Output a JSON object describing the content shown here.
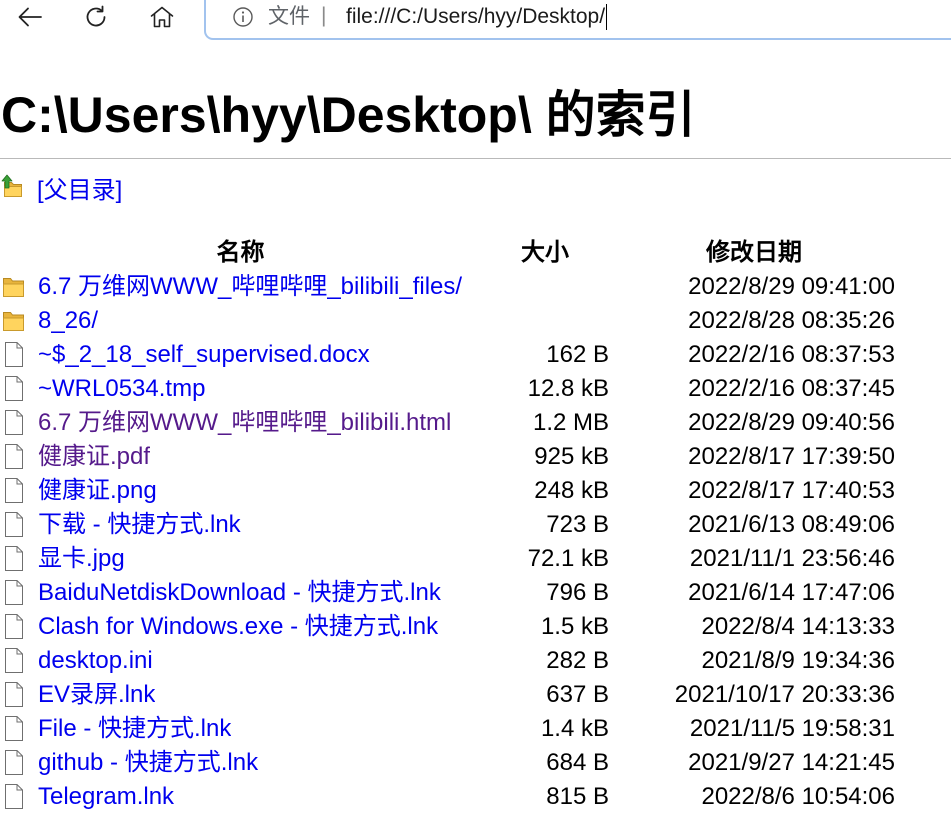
{
  "browser": {
    "back_icon": "arrow-left-icon",
    "refresh_icon": "refresh-icon",
    "home_icon": "home-icon",
    "address_bar": {
      "info_icon": "info-icon",
      "scheme_label": "文件",
      "separator": "|",
      "url": "file:///C:/Users/hyy/Desktop/"
    }
  },
  "page": {
    "title": "C:\\Users\\hyy\\Desktop\\ 的索引",
    "parent_icon": "parent-folder-icon",
    "parent_link": "[父目录]",
    "columns": {
      "name": "名称",
      "size": "大小",
      "modified": "修改日期"
    },
    "entries": [
      {
        "icon": "folder-icon",
        "name": "6.7 万维网WWW_哔哩哔哩_bilibili_files/",
        "modified": "2022/8/29 09:41:00",
        "visited": false
      },
      {
        "icon": "folder-icon",
        "name": "8_26/",
        "modified": "2022/8/28 08:35:26",
        "visited": false
      },
      {
        "icon": "file-icon",
        "name": "~$_2_18_self_supervised.docx",
        "size": "162 B",
        "modified": "2022/2/16 08:37:53",
        "visited": false
      },
      {
        "icon": "file-icon",
        "name": "~WRL0534.tmp",
        "size": "12.8 kB",
        "modified": "2022/2/16 08:37:45",
        "visited": false
      },
      {
        "icon": "file-icon",
        "name": "6.7 万维网WWW_哔哩哔哩_bilibili.html",
        "size": "1.2 MB",
        "modified": "2022/8/29 09:40:56",
        "visited": true
      },
      {
        "icon": "file-icon",
        "name": "健康证.pdf",
        "size": "925 kB",
        "modified": "2022/8/17 17:39:50",
        "visited": true
      },
      {
        "icon": "file-icon",
        "name": "健康证.png",
        "size": "248 kB",
        "modified": "2022/8/17 17:40:53",
        "visited": false
      },
      {
        "icon": "file-icon",
        "name": "下载 - 快捷方式.lnk",
        "size": "723 B",
        "modified": "2021/6/13 08:49:06",
        "visited": false
      },
      {
        "icon": "file-icon",
        "name": "显卡.jpg",
        "size": "72.1 kB",
        "modified": "2021/11/1 23:56:46",
        "visited": false
      },
      {
        "icon": "file-icon",
        "name": "BaiduNetdiskDownload - 快捷方式.lnk",
        "size": "796 B",
        "modified": "2021/6/14 17:47:06",
        "visited": false
      },
      {
        "icon": "file-icon",
        "name": "Clash for Windows.exe - 快捷方式.lnk",
        "size": "1.5 kB",
        "modified": "2022/8/4 14:13:33",
        "visited": false
      },
      {
        "icon": "file-icon",
        "name": "desktop.ini",
        "size": "282 B",
        "modified": "2021/8/9 19:34:36",
        "visited": false
      },
      {
        "icon": "file-icon",
        "name": "EV录屏.lnk",
        "size": "637 B",
        "modified": "2021/10/17 20:33:36",
        "visited": false
      },
      {
        "icon": "file-icon",
        "name": "File - 快捷方式.lnk",
        "size": "1.4 kB",
        "modified": "2021/11/5 19:58:31",
        "visited": false
      },
      {
        "icon": "file-icon",
        "name": "github - 快捷方式.lnk",
        "size": "684 B",
        "modified": "2021/9/27 14:21:45",
        "visited": false
      },
      {
        "icon": "file-icon",
        "name": "Telegram.lnk",
        "size": "815 B",
        "modified": "2022/8/6 10:54:06",
        "visited": false
      }
    ]
  },
  "colors": {
    "link": "#0000ee",
    "visited_link": "#551a8b",
    "focus_ring": "#a2c3ee",
    "text": "#000000",
    "muted": "#5f6368"
  }
}
